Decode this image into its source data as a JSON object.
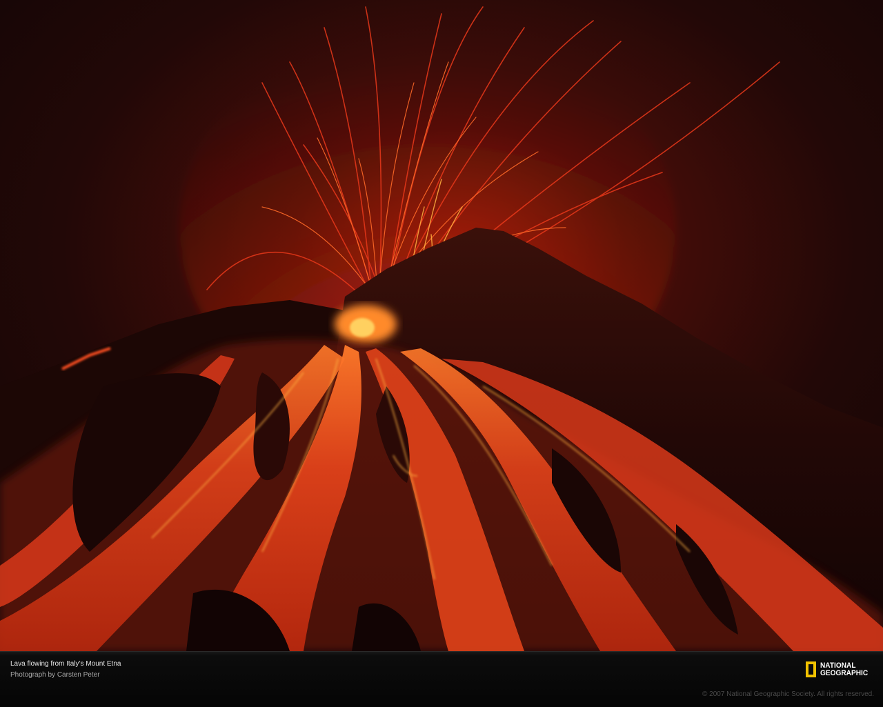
{
  "caption": {
    "title": "Lava flowing from Italy’s Mount Etna",
    "credit": "Photograph by Carsten Peter"
  },
  "logo": {
    "line1": "NATIONAL",
    "line2": "GEOGRAPHIC"
  },
  "copyright": "© 2007 National Geographic Society. All rights reserved.",
  "colors": {
    "lava": "#e0421a",
    "lava_bright": "#ffb040",
    "sky": "#1a0806",
    "logo_yellow": "#f2c200"
  }
}
